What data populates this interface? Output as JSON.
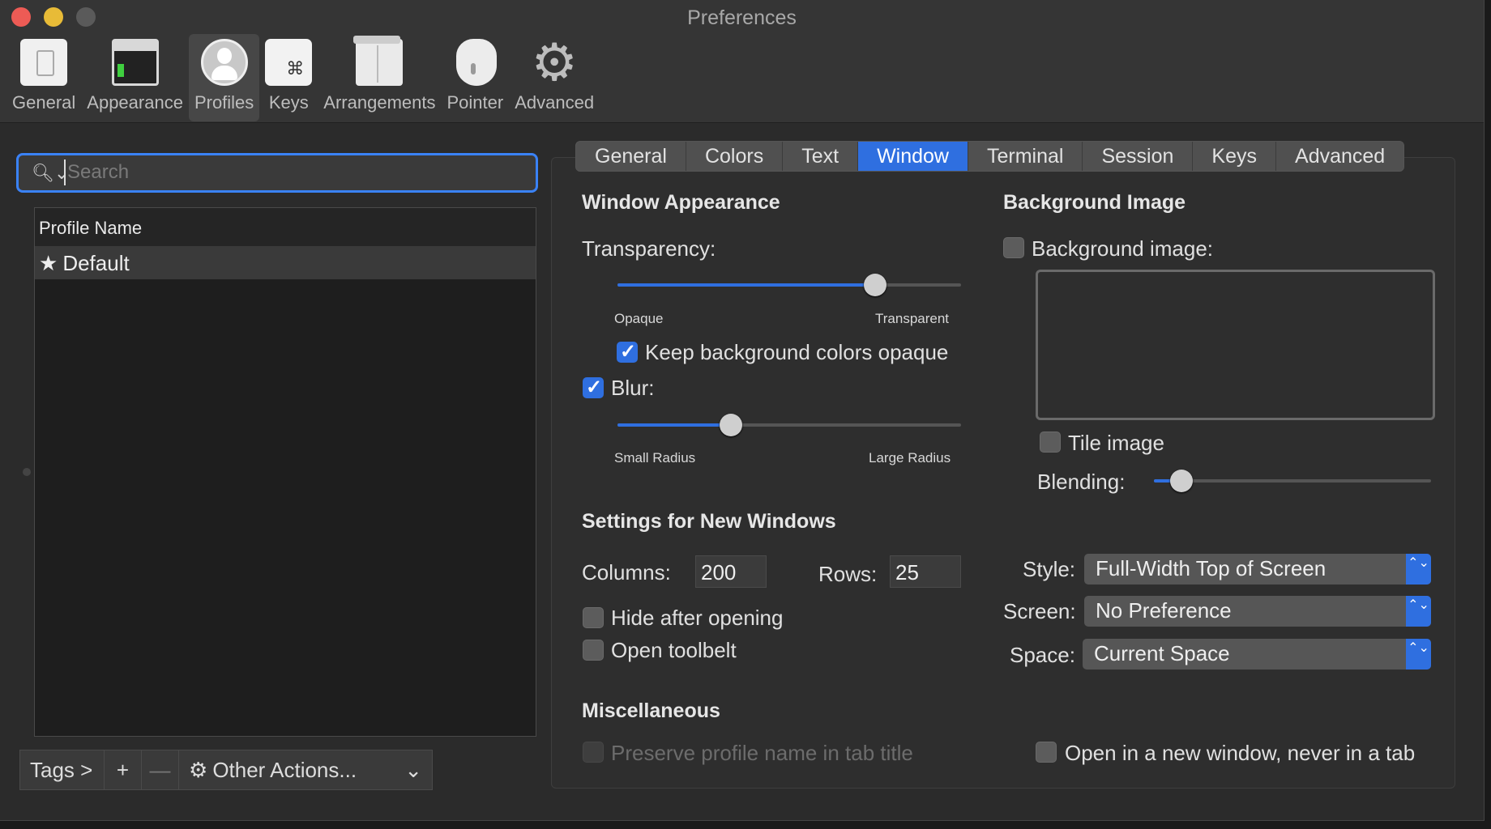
{
  "window": {
    "title": "Preferences"
  },
  "toolbar": {
    "items": [
      {
        "label": "General",
        "icon": "general-icon"
      },
      {
        "label": "Appearance",
        "icon": "appearance-icon"
      },
      {
        "label": "Profiles",
        "icon": "profiles-icon",
        "active": true
      },
      {
        "label": "Keys",
        "icon": "keys-icon",
        "glyph": "⌘"
      },
      {
        "label": "Arrangements",
        "icon": "arrangements-icon"
      },
      {
        "label": "Pointer",
        "icon": "pointer-icon"
      },
      {
        "label": "Advanced",
        "icon": "gear-icon",
        "glyph": "⚙"
      }
    ]
  },
  "search": {
    "placeholder": "Search",
    "value": "",
    "icon_glyph": "🔍︎⌄"
  },
  "profiles": {
    "header": "Profile Name",
    "rows": [
      {
        "name": "Default",
        "star": "★"
      }
    ]
  },
  "bottom_bar": {
    "tags": "Tags >",
    "add": "+",
    "remove": "—",
    "actions_icon": "⚙",
    "actions": "Other Actions...",
    "actions_caret": "⌄"
  },
  "tabs": {
    "items": [
      "General",
      "Colors",
      "Text",
      "Window",
      "Terminal",
      "Session",
      "Keys",
      "Advanced"
    ],
    "active": "Window"
  },
  "window_appearance": {
    "heading": "Window Appearance",
    "transparency_label": "Transparency:",
    "transparency_value": 0.75,
    "opaque_label": "Opaque",
    "transparent_label": "Transparent",
    "keep_bg_opaque": {
      "label": "Keep background colors opaque",
      "checked": true
    },
    "blur": {
      "label": "Blur:",
      "checked": true,
      "value": 0.33
    },
    "small_radius_label": "Small Radius",
    "large_radius_label": "Large Radius"
  },
  "background_image": {
    "heading": "Background Image",
    "checkbox_label": "Background image:",
    "checked": false,
    "tile_label": "Tile image",
    "tile_checked": false,
    "blending_label": "Blending:",
    "blending_value": 0.1
  },
  "new_windows": {
    "heading": "Settings for New Windows",
    "columns_label": "Columns:",
    "columns_value": "200",
    "rows_label": "Rows:",
    "rows_value": "25",
    "hide_after_opening": {
      "label": "Hide after opening",
      "checked": false
    },
    "open_toolbelt": {
      "label": "Open toolbelt",
      "checked": false
    },
    "style_label": "Style:",
    "style_value": "Full-Width Top of Screen",
    "screen_label": "Screen:",
    "screen_value": "No Preference",
    "space_label": "Space:",
    "space_value": "Current Space",
    "popup_arrows": "⌃⌄"
  },
  "misc": {
    "heading": "Miscellaneous",
    "preserve_name": {
      "label": "Preserve profile name in tab title",
      "checked": false,
      "disabled": true
    },
    "open_new_window": {
      "label": "Open in a new window, never in a tab",
      "checked": false
    }
  },
  "colors": {
    "accent": "#2f6fe0",
    "focus": "#3a82f7",
    "close": "#ed5b55",
    "minimize": "#e8bb37"
  }
}
